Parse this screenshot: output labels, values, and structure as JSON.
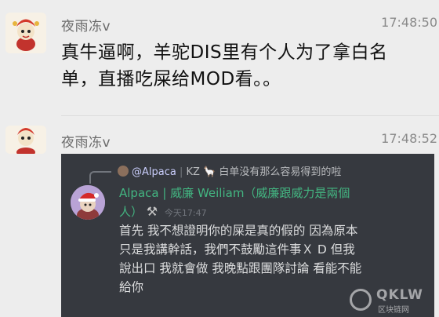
{
  "messages": [
    {
      "sender": "夜雨冻v",
      "time": "17:48:50",
      "text_line1": "真牛逼啊，羊驼DIS里有个人为了拿白名",
      "text_line2": "单，直播吃屎给MOD看。。"
    },
    {
      "sender": "夜雨冻v",
      "time": "17:48:52"
    }
  ],
  "discord": {
    "reply_mention": "@Alpaca",
    "reply_sep": " | ",
    "reply_tag": "KZ",
    "reply_text": "白单没有那么容易得到的啦",
    "username_line1": "Alpaca | 威廉 Weiliam（威廉跟威力是兩個",
    "username_line2": "人）",
    "timestamp": "今天17:47",
    "body_lines": [
      "首先 我不想證明你的屎是真的假的 因為原本",
      "只是我講幹話，我們不鼓勵這件事Ｘ D 但我",
      "說出口 我就會做 我晚點跟團隊討論 看能不能",
      "給你"
    ]
  },
  "watermark": {
    "brand": "QKLW",
    "sub": "区块链网"
  },
  "icons": {
    "tool": "hammer-wrench-icon",
    "llama": "llama-emoji-icon"
  }
}
